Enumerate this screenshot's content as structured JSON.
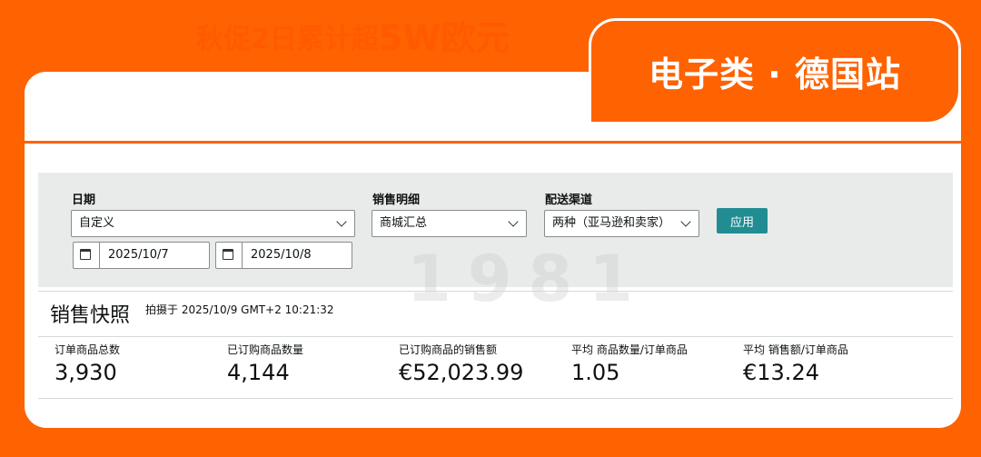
{
  "banner": {
    "promo_small": "秋促2日累计超",
    "promo_big": "5W欧元",
    "badge": "电子类 · 德国站",
    "accent": "#ff6200"
  },
  "filters": {
    "date_label": "日期",
    "date_value": "自定义",
    "start_date": "2025/10/7",
    "end_date": "2025/10/8",
    "sales_label": "销售明细",
    "sales_value": "商城汇总",
    "channel_label": "配送渠道",
    "channel_value": "两种（亚马逊和卖家）",
    "apply": "应用"
  },
  "snapshot": {
    "title": "销售快照",
    "time": "拍摄于 2025/10/9 GMT+2 10:21:32"
  },
  "metrics": [
    {
      "label": "订单商品总数",
      "value": "3,930"
    },
    {
      "label": "已订购商品数量",
      "value": "4,144"
    },
    {
      "label": "已订购商品的销售额",
      "value": "€52,023.99"
    },
    {
      "label": "平均 商品数量/订单商品",
      "value": "1.05"
    },
    {
      "label": "平均 销售额/订单商品",
      "value": "€13.24"
    }
  ],
  "colors": {
    "button": "#218d93",
    "panel": "#e9ebeb"
  }
}
